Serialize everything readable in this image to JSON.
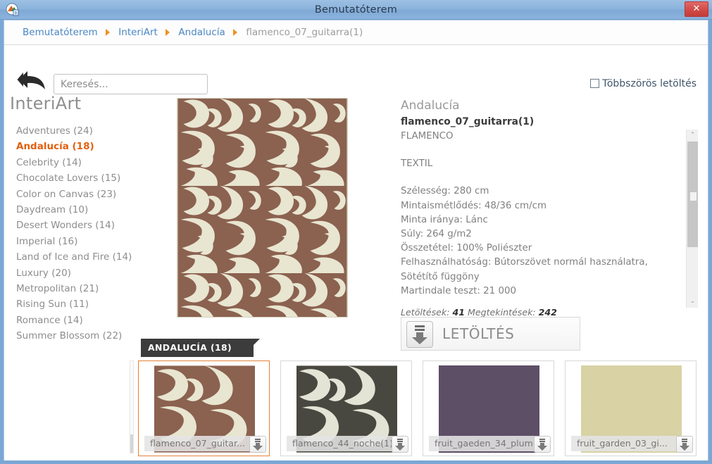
{
  "window": {
    "title": "Bemutatóterem",
    "close_label": "✕",
    "app_icon": "app-logo-icon"
  },
  "breadcrumb": {
    "items": [
      {
        "label": "Bemutatóterem",
        "current": false
      },
      {
        "label": "InteriArt",
        "current": false
      },
      {
        "label": "Andalucía",
        "current": false
      },
      {
        "label": "flamenco_07_guitarra(1)",
        "current": true
      }
    ]
  },
  "toolbar": {
    "back_icon": "back-arrow-icon",
    "search_placeholder": "Keresés...",
    "search_value": "",
    "multi_download_label": "Többszörös letöltés",
    "multi_download_checked": false
  },
  "sidebar": {
    "brand": "InteriArt",
    "items": [
      {
        "label": "Adventures (24)",
        "active": false
      },
      {
        "label": "Andalucía (18)",
        "active": true
      },
      {
        "label": "Celebrity (14)",
        "active": false
      },
      {
        "label": "Chocolate Lovers (15)",
        "active": false
      },
      {
        "label": "Color on Canvas (23)",
        "active": false
      },
      {
        "label": "Daydream (10)",
        "active": false
      },
      {
        "label": "Desert Wonders (14)",
        "active": false
      },
      {
        "label": "Imperial (16)",
        "active": false
      },
      {
        "label": "Land of Ice and Fire (14)",
        "active": false
      },
      {
        "label": "Luxury (20)",
        "active": false
      },
      {
        "label": "Metropolitan (21)",
        "active": false
      },
      {
        "label": "Rising Sun (11)",
        "active": false
      },
      {
        "label": "Romance (14)",
        "active": false
      },
      {
        "label": "Summer Blossom (22)",
        "active": false
      }
    ]
  },
  "preview": {
    "alt": "flamenco_07_guitarra(1) damask pattern",
    "base_color": "#e8e5d0",
    "motif_color": "#8b6150"
  },
  "detail": {
    "collection": "Andalucía",
    "product_name": "flamenco_07_guitarra(1)",
    "design": "FLAMENCO",
    "material": "TEXTIL",
    "specs": [
      "Szélesség: 280 cm",
      "Mintaismétlődés: 48/36 cm/cm",
      "Minta iránya: Lánc",
      "Súly: 264 g/m2",
      "Összetétel: 100% Poliészter",
      "Felhasználhatóság: Bútorszövet normál használatra, Sötétítő függöny",
      "Martindale teszt: 21 000"
    ],
    "stats_downloads_label": "Letöltések:",
    "stats_downloads_value": "41",
    "stats_views_label": "Megtekintések:",
    "stats_views_value": "242",
    "scrollbar": {
      "up_glyph": "⌃",
      "down_glyph": "⌄"
    }
  },
  "download_button": {
    "label": "LETÖLTÉS",
    "icon": "download-icon"
  },
  "thumbnails": {
    "tooltip": "ANDALUCÍA (18)",
    "items": [
      {
        "caption": "flamenco_07_guitar...",
        "selected": true,
        "base_color": "#e8e5d0",
        "motif_color": "#8b6150",
        "type": "damask"
      },
      {
        "caption": "flamenco_44_noche(1)",
        "selected": false,
        "base_color": "#e3e4d6",
        "motif_color": "#494840",
        "type": "damask"
      },
      {
        "caption": "fruit_gaeden_34_plum",
        "selected": false,
        "base_color": "#594a62",
        "motif_color": "#594a62",
        "type": "solid"
      },
      {
        "caption": "fruit_garden_03_gi...",
        "selected": false,
        "base_color": "#ddd6a8",
        "motif_color": "#ddd6a8",
        "type": "solid"
      }
    ]
  },
  "colors": {
    "accent_orange": "#e2610f",
    "link_blue": "#4a87c4",
    "titlebar_blue": "#7ba7d4",
    "close_red": "#cf4845",
    "muted_text": "#8d8d8d"
  }
}
